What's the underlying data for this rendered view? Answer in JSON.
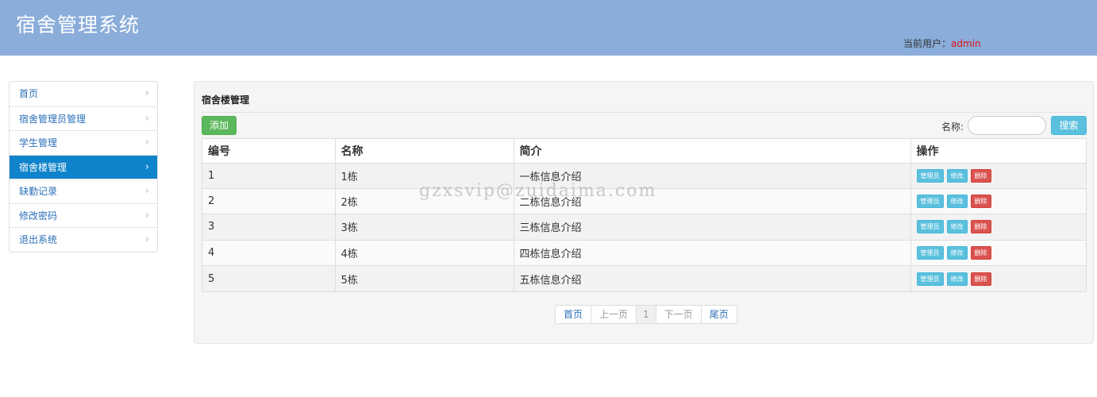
{
  "header": {
    "title": "宿舍管理系统",
    "user_label": "当前用户：",
    "user_name": "admin"
  },
  "sidebar": {
    "items": [
      {
        "label": "首页",
        "active": false
      },
      {
        "label": "宿舍管理员管理",
        "active": false
      },
      {
        "label": "学生管理",
        "active": false
      },
      {
        "label": "宿舍楼管理",
        "active": true
      },
      {
        "label": "缺勤记录",
        "active": false
      },
      {
        "label": "修改密码",
        "active": false
      },
      {
        "label": "退出系统",
        "active": false
      }
    ]
  },
  "panel": {
    "title": "宿舍楼管理",
    "add_label": "添加",
    "search_label": "名称:",
    "search_value": "",
    "search_button": "搜索"
  },
  "table": {
    "columns": [
      "编号",
      "名称",
      "简介",
      "操作"
    ],
    "rows": [
      {
        "id": "1",
        "name": "1栋",
        "desc": "一栋信息介绍"
      },
      {
        "id": "2",
        "name": "2栋",
        "desc": "二栋信息介绍"
      },
      {
        "id": "3",
        "name": "3栋",
        "desc": "三栋信息介绍"
      },
      {
        "id": "4",
        "name": "4栋",
        "desc": "四栋信息介绍"
      },
      {
        "id": "5",
        "name": "5栋",
        "desc": "五栋信息介绍"
      }
    ],
    "actions": {
      "manager": "管理员",
      "edit": "修改",
      "delete": "删除"
    }
  },
  "pager": {
    "first": "首页",
    "prev": "上一页",
    "current": "1",
    "next": "下一页",
    "last": "尾页"
  },
  "watermark": "gzxsvip@zuidaima.com",
  "colors": {
    "header_bg": "#8aadda",
    "active_nav": "#0f83cb",
    "add_button": "#5cb85c",
    "info_button": "#5bc0de",
    "danger_button": "#d9534f",
    "username": "#e0101a"
  }
}
